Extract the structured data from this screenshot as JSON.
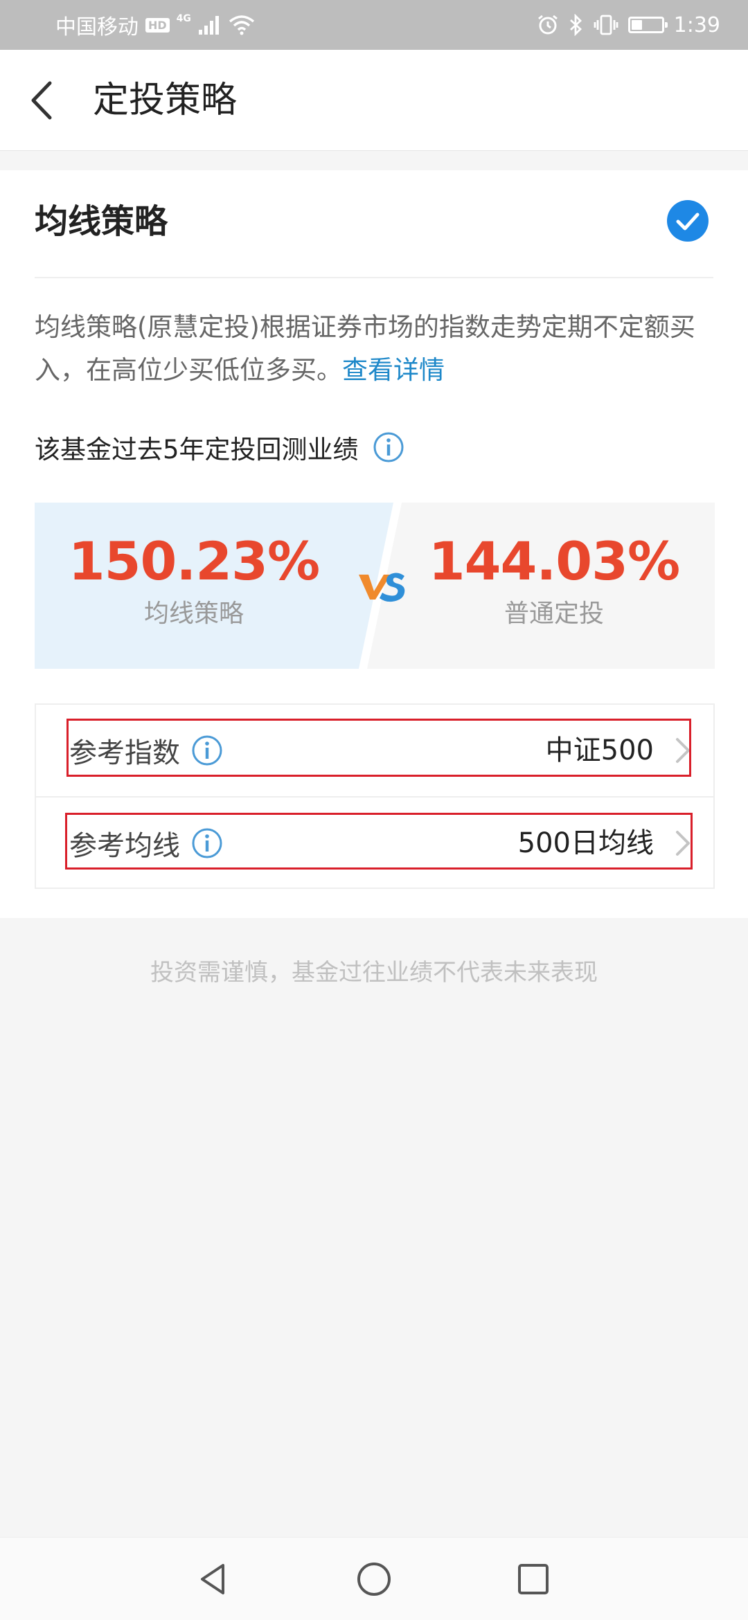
{
  "status_bar": {
    "carrier": "中国移动",
    "hd": "HD",
    "network": "4G",
    "time": "1:39",
    "battery_level": 0.35
  },
  "header": {
    "title": "定投策略",
    "back_icon": "chevron-left-icon"
  },
  "strategy": {
    "title": "均线策略",
    "selected": true,
    "description": "均线策略(原慧定投)根据证券市场的指数走势定期不定额买入，在高位少买低位多买。",
    "detail_link": "查看详情"
  },
  "backtest": {
    "label": "该基金过去5年定投回测业绩",
    "left_value": "150.23%",
    "left_label": "均线策略",
    "right_value": "144.03%",
    "right_label": "普通定投"
  },
  "reference": {
    "index_label": "参考指数",
    "index_value": "中证500",
    "ma_label": "参考均线",
    "ma_value": "500日均线"
  },
  "disclaimer": "投资需谨慎，基金过往业绩不代表未来表现",
  "colors": {
    "accent": "#1e88c9",
    "return_red": "#e8472d",
    "highlight": "#d91f2a"
  }
}
